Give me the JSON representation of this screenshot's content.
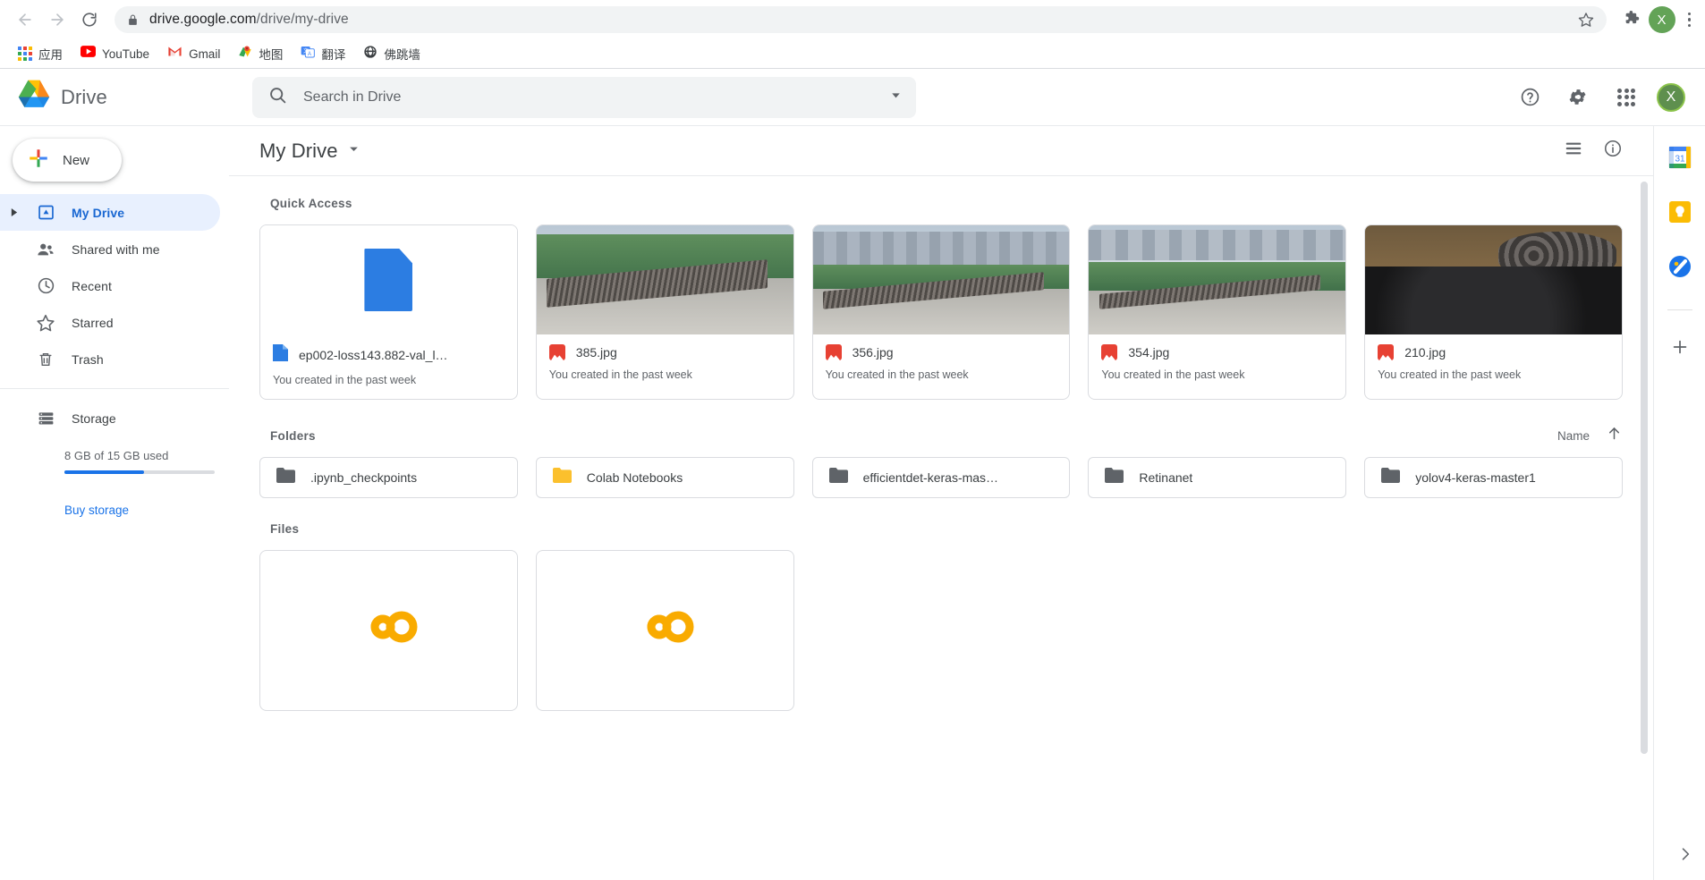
{
  "browser": {
    "url_bold": "drive.google.com",
    "url_rest": "/drive/my-drive",
    "back_icon": "back-arrow-icon",
    "forward_icon": "forward-arrow-icon",
    "reload_icon": "reload-icon",
    "lock_icon": "lock-icon",
    "star_icon": "star-icon",
    "extensions_icon": "puzzle-piece-icon",
    "profile_initial": "X",
    "menu_icon": "three-dot-menu-icon",
    "bookmarks": [
      {
        "label": "应用",
        "icon": "apps-grid-icon"
      },
      {
        "label": "YouTube",
        "icon": "youtube-icon"
      },
      {
        "label": "Gmail",
        "icon": "gmail-icon"
      },
      {
        "label": "地图",
        "icon": "google-maps-icon"
      },
      {
        "label": "翻译",
        "icon": "google-translate-icon"
      },
      {
        "label": "佛跳墙",
        "icon": "globe-icon"
      }
    ]
  },
  "drive_header": {
    "product_name": "Drive",
    "logo_icon": "google-drive-logo",
    "search_placeholder": "Search in Drive",
    "search_value": "",
    "search_icon": "search-icon",
    "search_options_icon": "chevron-down-icon",
    "help_icon": "help-circle-icon",
    "settings_icon": "gear-icon",
    "apps_icon": "google-apps-waffle-icon",
    "account_initial": "X"
  },
  "sidebar": {
    "new_button": "New",
    "new_icon": "plus-icon",
    "items": [
      {
        "label": "My Drive",
        "icon": "my-drive-icon",
        "active": true,
        "expandable": true
      },
      {
        "label": "Shared with me",
        "icon": "people-icon",
        "active": false,
        "expandable": false
      },
      {
        "label": "Recent",
        "icon": "clock-icon",
        "active": false,
        "expandable": false
      },
      {
        "label": "Starred",
        "icon": "star-outline-icon",
        "active": false,
        "expandable": false
      },
      {
        "label": "Trash",
        "icon": "trash-icon",
        "active": false,
        "expandable": false
      }
    ],
    "storage": {
      "label": "Storage",
      "icon": "storage-icon",
      "usage_text": "8 GB of 15 GB used",
      "used_percent": 53,
      "bar_color": "#1a73e8",
      "buy_link": "Buy storage"
    }
  },
  "main": {
    "breadcrumb_title": "My Drive",
    "breadcrumb_caret_icon": "chevron-down-icon",
    "list_view_icon": "list-view-icon",
    "details_icon": "info-circle-icon",
    "quick_access_title": "Quick Access",
    "quick_access": [
      {
        "name": "ep002-loss143.882-val_l…",
        "subtitle": "You created in the past week",
        "icon": "blue-file-icon",
        "thumb": "document"
      },
      {
        "name": "385.jpg",
        "subtitle": "You created in the past week",
        "icon": "image-file-icon",
        "thumb": "photo-rebar-site"
      },
      {
        "name": "356.jpg",
        "subtitle": "You created in the past week",
        "icon": "image-file-icon",
        "thumb": "photo-city-road"
      },
      {
        "name": "354.jpg",
        "subtitle": "You created in the past week",
        "icon": "image-file-icon",
        "thumb": "photo-green-fence"
      },
      {
        "name": "210.jpg",
        "subtitle": "You created in the past week",
        "icon": "image-file-icon",
        "thumb": "photo-pipe-trench"
      }
    ],
    "folders_title": "Folders",
    "sort_label": "Name",
    "sort_direction_icon": "arrow-up-icon",
    "folders": [
      {
        "name": ".ipynb_checkpoints",
        "color": "#5f6368"
      },
      {
        "name": "Colab Notebooks",
        "color": "#fbbc04"
      },
      {
        "name": "efficientdet-keras-mas…",
        "color": "#5f6368"
      },
      {
        "name": "Retinanet",
        "color": "#5f6368"
      },
      {
        "name": "yolov4-keras-master1",
        "color": "#5f6368"
      }
    ],
    "files_title": "Files",
    "files": [
      {
        "name": "",
        "icon": "colab-icon"
      },
      {
        "name": "",
        "icon": "colab-icon"
      }
    ]
  },
  "right_rail": {
    "items": [
      {
        "icon": "google-calendar-icon",
        "badge": "31"
      },
      {
        "icon": "google-keep-icon"
      },
      {
        "icon": "google-tasks-icon"
      }
    ],
    "add_icon": "plus-icon",
    "expand_icon": "chevron-right-icon"
  }
}
